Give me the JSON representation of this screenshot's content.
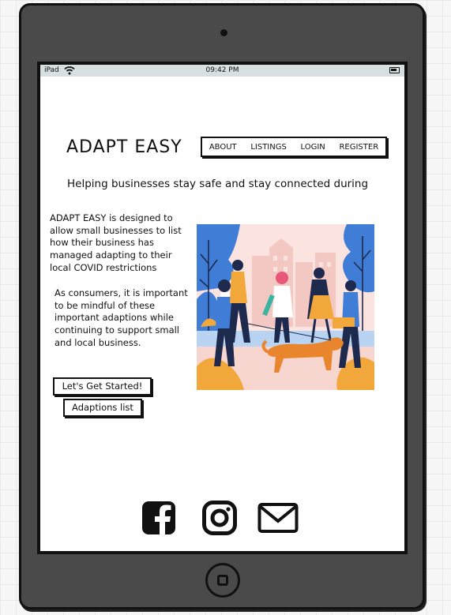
{
  "status_bar": {
    "carrier": "iPad",
    "time": "09:42 PM",
    "icons": [
      "wifi-icon",
      "battery-icon"
    ]
  },
  "header": {
    "logo": "ADAPT EASY",
    "nav": [
      "ABOUT",
      "LISTINGS",
      "LOGIN",
      "REGISTER"
    ]
  },
  "main": {
    "tagline": "Helping businesses stay safe and stay connected during",
    "intro": "ADAPT EASY is designed to allow small businesses to list how their business has managed adapting to their local COVID restrictions",
    "consumers": "As consumers, it is important to be mindful of these important adaptions while continuing to support small and local business.",
    "buttons": {
      "get_started": "Let's Get Started!",
      "adaptions_list": "Adaptions list"
    },
    "illustration": "people-walking-with-masks-illustration"
  },
  "footer": {
    "social_icons": [
      "facebook-icon",
      "instagram-icon",
      "mail-icon"
    ]
  },
  "colors": {
    "device_frame": "#4a4a4a",
    "status_bar": "#d7dfe3",
    "illustration_blue": "#3f7dd6",
    "illustration_orange": "#f2a73b",
    "illustration_pink": "#f7d3cd"
  }
}
